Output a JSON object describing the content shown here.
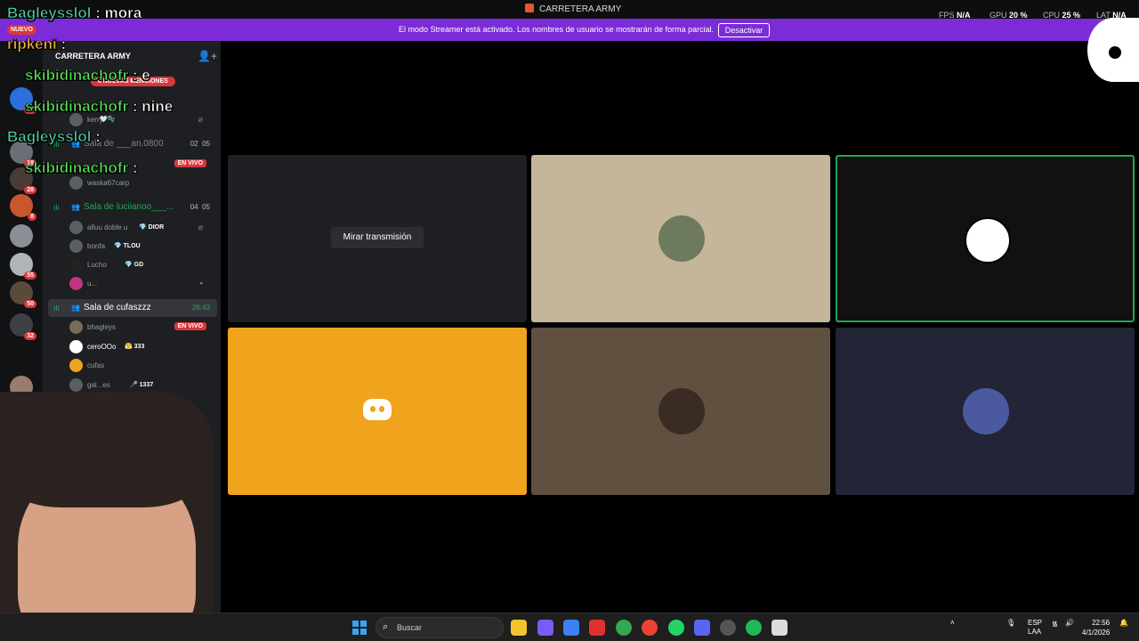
{
  "window": {
    "title": "CARRETERA ARMY",
    "metrics": [
      {
        "label": "FPS",
        "value": "N/A"
      },
      {
        "label": "GPU",
        "value": "20 %"
      },
      {
        "label": "CPU",
        "value": "25 %"
      },
      {
        "label": "LAT",
        "value": "N/A"
      }
    ]
  },
  "banner": {
    "message": "El modo Streamer está activado. Los nombres de usuario se mostrarán de forma parcial.",
    "button": "Desactivar"
  },
  "servers": {
    "nuevo": "NUEVO",
    "badges": [
      "65",
      "19",
      "28",
      "8",
      "55",
      "50",
      "32",
      "202"
    ]
  },
  "channels": {
    "server_name": "CARRETERA ARMY",
    "new_mentions": "6 NUEVAS MENCIONES",
    "rooms": [
      {
        "name": "Sala de ___an.0800",
        "count_a": "02",
        "count_b": "05"
      },
      {
        "name": "Sala de luciianoo___...",
        "count_a": "04",
        "count_b": "05"
      },
      {
        "name": "Sala de cufaszzz",
        "timer": "26:43"
      }
    ],
    "users": [
      {
        "name": "kerry",
        "tag": "🤍🫧"
      },
      {
        "name": "waska67carp",
        "tag": ""
      },
      {
        "name": "alluu doble u",
        "tag": "💎 DIOR"
      },
      {
        "name": "bonfa",
        "tag": "💎 TLOU"
      },
      {
        "name": "Lucho",
        "tag": "💎 GD"
      },
      {
        "name": "u...",
        "tag": ""
      },
      {
        "name": "bhagleys",
        "tag": ""
      },
      {
        "name": "ceroOOo",
        "tag": "😤 333"
      },
      {
        "name": "cufas",
        "tag": ""
      },
      {
        "name": "gal...es",
        "tag": "🎤 1337"
      }
    ],
    "live_label": "EN VIVO"
  },
  "chat": [
    {
      "user": "Bagleysslol",
      "text": "mora",
      "color": "#4fc7a0"
    },
    {
      "user": "ripkeni",
      "text": "",
      "color": "#f0b340"
    },
    {
      "user": "skibidinachofr",
      "text": "e",
      "color": "#5be35b"
    },
    {
      "user": "skibidinachofr",
      "text": "nine",
      "color": "#5be35b"
    },
    {
      "user": "Bagleysslol",
      "text": "",
      "color": "#4fc7a0"
    },
    {
      "user": "skibidinachofr",
      "text": "",
      "color": "#5be35b"
    }
  ],
  "stage": {
    "watch_stream": "Mirar transmisión",
    "tile_colors": [
      "#1f2023",
      "#c4b59b",
      "#111111",
      "#f0a31d",
      "#5f5040",
      "#232436"
    ]
  },
  "taskbar": {
    "search": "Buscar",
    "lang_top": "ESP",
    "lang_bottom": "LAA",
    "time": "22:56",
    "date": "4/1/2026"
  }
}
